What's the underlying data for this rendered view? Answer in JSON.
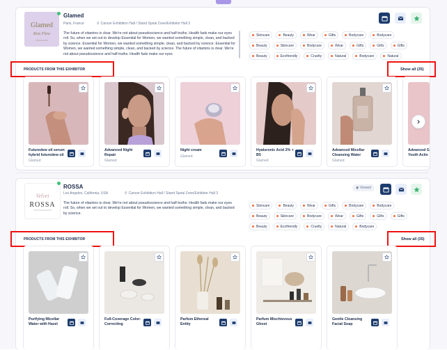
{
  "exhibitors": [
    {
      "name": "Glamed",
      "city": "Paris, France",
      "hall": "Cancer Exhibition Hall / Stand Spiral Zone/Exhibitor Hall 3",
      "description": "The future of vitamins is clear. We're not about pseudoscience and half-truths. Health fads make our eyes roll. So, when we set out to develop Essential for Women, we wanted something simple, clean, and backed by science. Essential for Women, we wanted something simple, clean, and backed by science. Essential for Women, we wanted something simple, clean, and backed by science. The future of vitamins is clear. We're not about pseudoscience and half-truths. Health fads make our eyes",
      "tags": [
        "Skincare",
        "Beauty",
        "Wear",
        "Gifts",
        "Bodycare",
        "Bodycare",
        "Beauty",
        "Skincare",
        "Bodycare",
        "Wear",
        "Gifts",
        "Gifts",
        "Gifts",
        "Beauty",
        "Ecofriendly",
        "Cruelty",
        "Natural",
        "Bodycare",
        "Natural"
      ],
      "logo_text": "Glamed",
      "logo_script": "Kiss Flow",
      "products_label": "PRODUCTS FROM THIS EXHIBITOR",
      "show_all": "Show all (35)",
      "products": [
        {
          "name": "Futuredew oil serum hybrid futuredew oil",
          "brand": "Glamed"
        },
        {
          "name": "Advanced Night Repair",
          "brand": "Glamed"
        },
        {
          "name": "Night cream",
          "brand": "Glamed"
        },
        {
          "name": "Hyaluronic Acid 2% + B5",
          "brand": "Glamed"
        },
        {
          "name": "Advanced Micellar Cleansing Water",
          "brand": "Glamed"
        },
        {
          "name": "Advanced G Youth Activ",
          "brand": "Glamed"
        }
      ]
    },
    {
      "name": "ROSSA",
      "city": "Los Angeles, California, USA",
      "hall": "Cancer Exhibition Hall / Stand Spiral Zone/Exhibitor Hall 3",
      "viewed": "Viewed",
      "description": "The future of vitamins is clear. We're not about pseudoscience and half-truths. Health fads make our eyes roll. So, when we set out to develop Essential for Women, we wanted something simple, clean, and backed by science.",
      "tags": [
        "Skincare",
        "Beauty",
        "Wear",
        "Gifts",
        "Bodycare",
        "Bodycare",
        "Beauty",
        "Skincare",
        "Bodycare",
        "Wear",
        "Gifts",
        "Gifts",
        "Gifts",
        "Beauty",
        "Ecofriendly",
        "Cruelty",
        "Natural",
        "Bodycare"
      ],
      "logo_script": "Velvet",
      "logo_text": "ROSSA",
      "products_label": "PRODUCTS FROM THIS EXHIBITOR",
      "show_all": "Show all (35)",
      "products": [
        {
          "name": "Purifying Micellar Water with Hazel",
          "brand": ""
        },
        {
          "name": "Full-Coverage Color-Correcting",
          "brand": ""
        },
        {
          "name": "Parfum Ethereal Entity",
          "brand": ""
        },
        {
          "name": "Parfum Mischievous Ghost",
          "brand": ""
        },
        {
          "name": "Gentle Cleansing Facial Soap",
          "brand": ""
        }
      ]
    }
  ],
  "colors": {
    "primary": "#1d3c6e",
    "accent_dot": "#f26b3a",
    "highlight": "#ee1111",
    "online": "#3cc07a"
  }
}
